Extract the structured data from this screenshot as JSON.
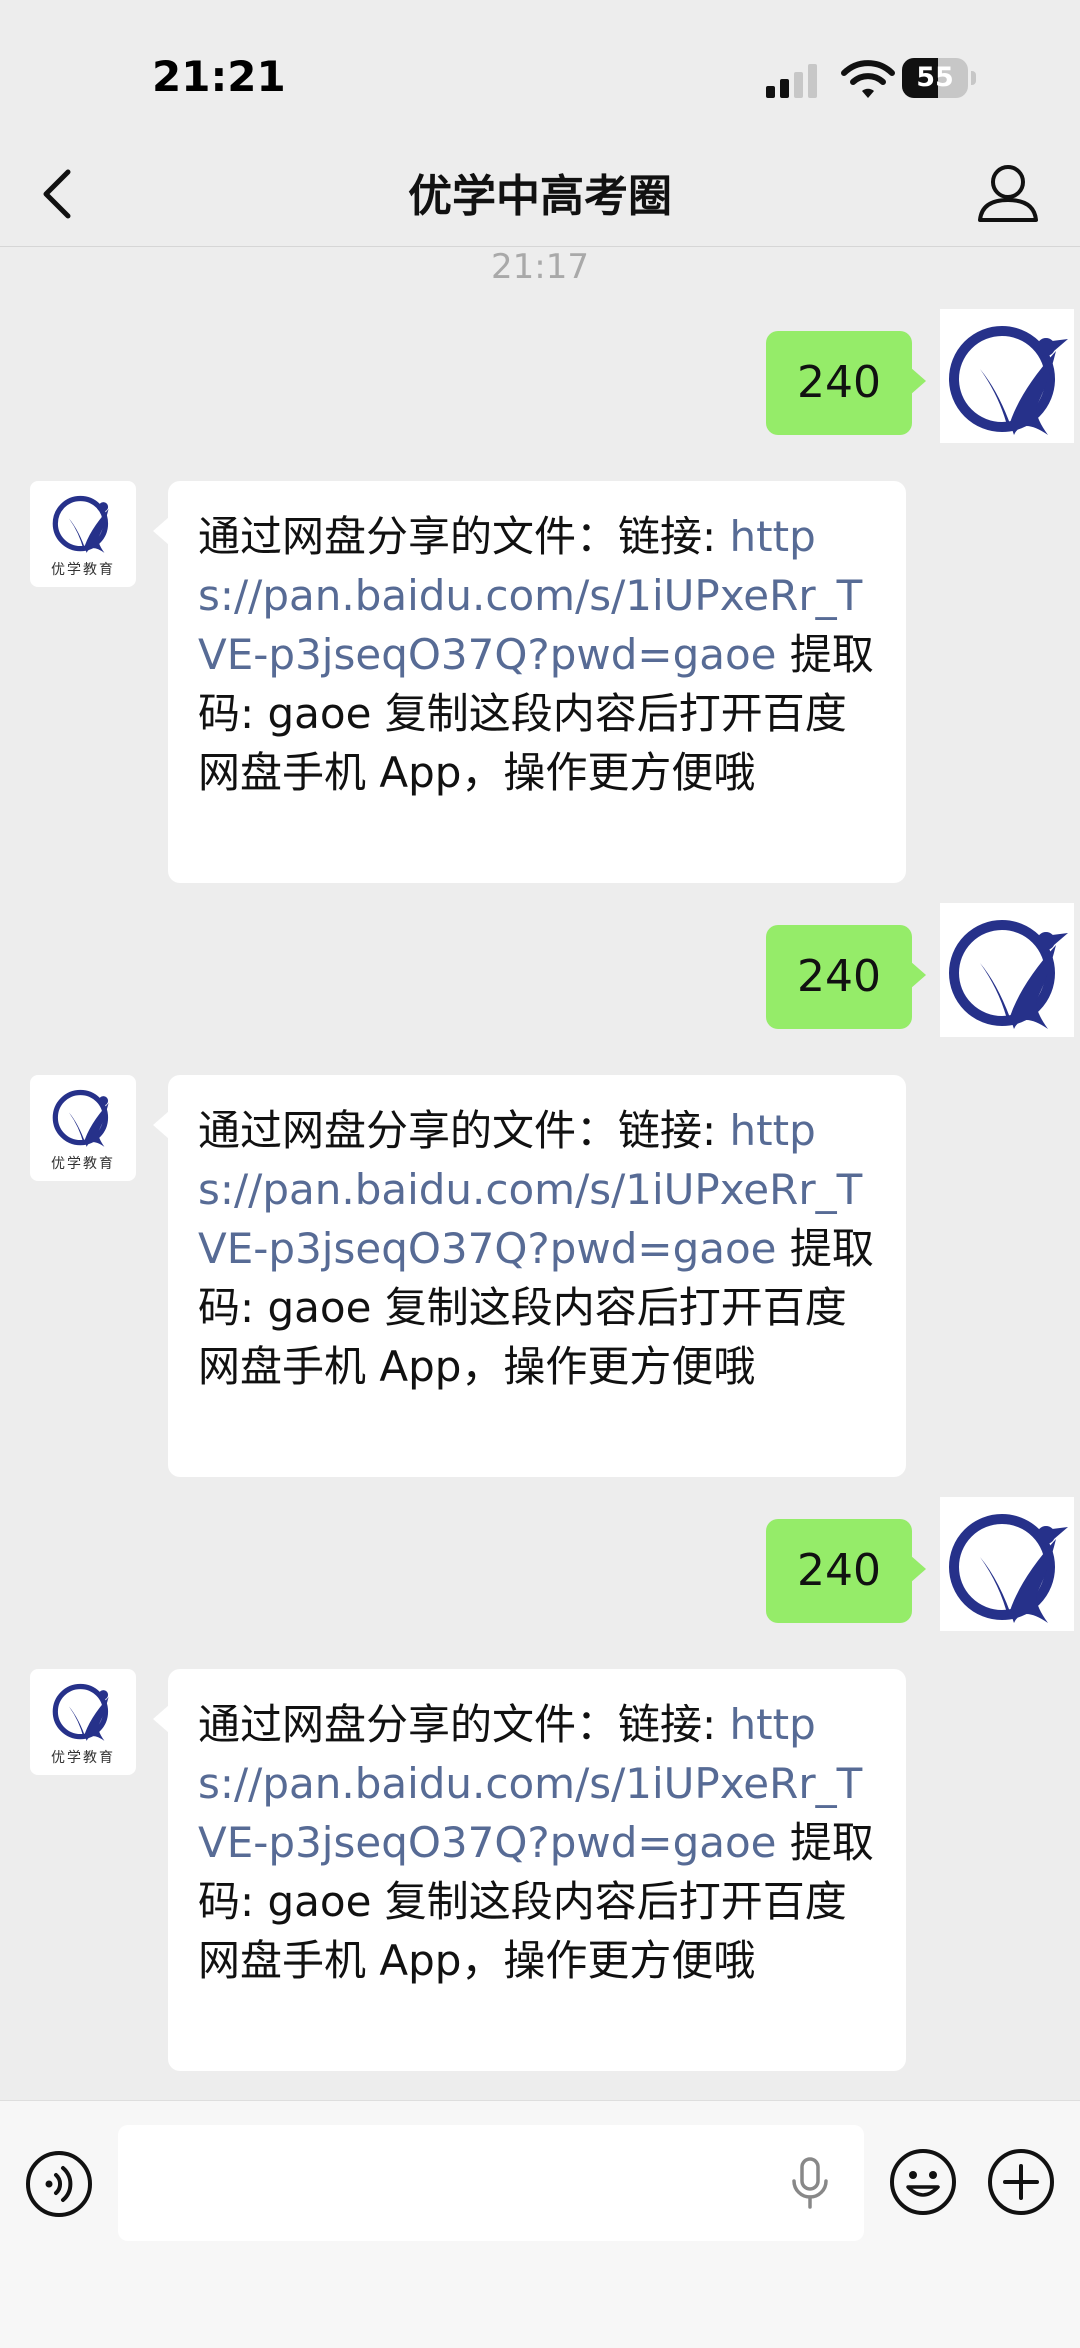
{
  "status_bar": {
    "time": "21:21",
    "battery": "55",
    "battery_level": 0.55
  },
  "header": {
    "title": "优学中高考圈",
    "back_icon": "chevron-left-icon",
    "profile_icon": "person-icon"
  },
  "chat": {
    "timestamp": "21:17",
    "messages": [
      {
        "from": "me",
        "text": "240"
      },
      {
        "from": "bot",
        "prefix": "通过网盘分享的文件：链接: ",
        "link": "https://pan.baidu.com/s/1iUPxeRr_TVE-p3jseqO37Q?pwd=gaoe",
        "suffix": " 提取码: gaoe 复制这段内容后打开百度网盘手机 App，操作更方便哦"
      },
      {
        "from": "me",
        "text": "240"
      },
      {
        "from": "bot",
        "prefix": "通过网盘分享的文件：链接: ",
        "link": "https://pan.baidu.com/s/1iUPxeRr_TVE-p3jseqO37Q?pwd=gaoe",
        "suffix": " 提取码: gaoe 复制这段内容后打开百度网盘手机 App，操作更方便哦"
      },
      {
        "from": "me",
        "text": "240"
      },
      {
        "from": "bot",
        "prefix": "通过网盘分享的文件：链接: ",
        "link": "https://pan.baidu.com/s/1iUPxeRr_TVE-p3jseqO37Q?pwd=gaoe",
        "suffix": " 提取码: gaoe 复制这段内容后打开百度网盘手机 App，操作更方便哦"
      }
    ],
    "bot_avatar_caption": "优学教育"
  },
  "input_bar": {
    "value": "",
    "icons": [
      "voice-icon",
      "microphone-icon",
      "emoji-icon",
      "plus-icon"
    ]
  },
  "colors": {
    "background": "#ededed",
    "outgoing_bubble": "#95ec69",
    "link": "#576b95",
    "brand_blue": "#26318a"
  }
}
